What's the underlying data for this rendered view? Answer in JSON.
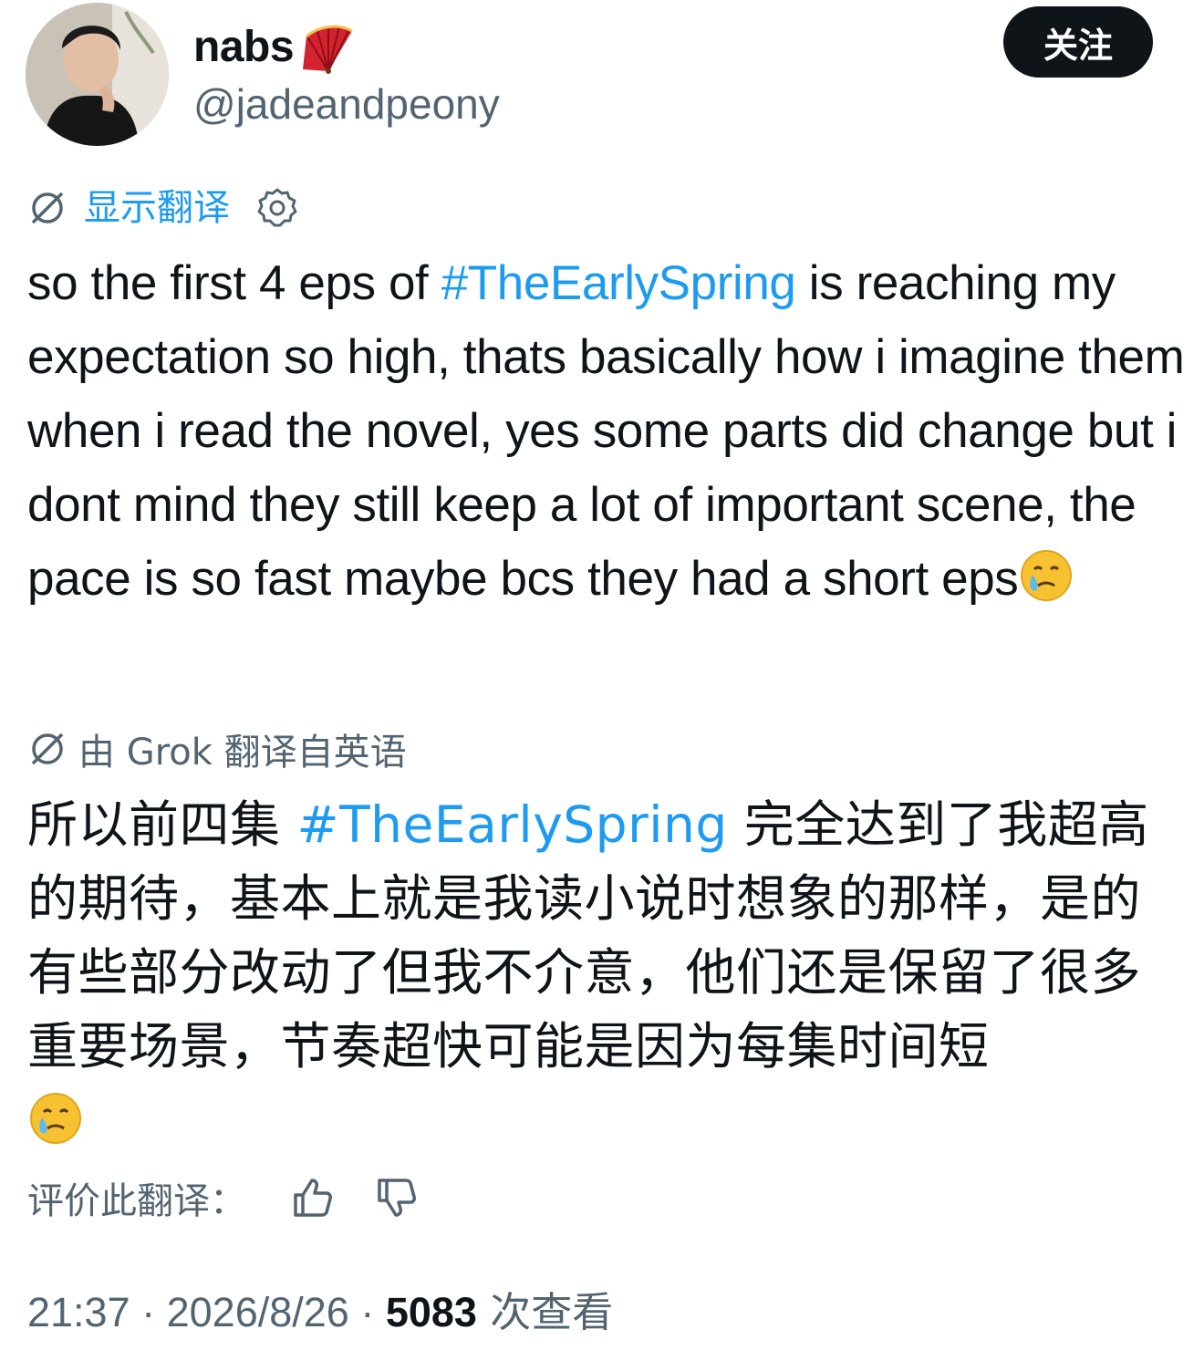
{
  "author": {
    "name": "nabs",
    "handle": "@jadeandpeony",
    "name_emoji": "folding-fan-icon"
  },
  "follow_button": {
    "label": "关注"
  },
  "translate_bar": {
    "label": "显示翻译",
    "icon": "translate-slash-icon",
    "settings_icon": "gear-icon"
  },
  "tweet": {
    "en_before": "so the first 4 eps of ",
    "hashtag": "#TheEarlySpring",
    "en_after": " is reaching my expectation so high, thats basically how i imagine them when i read the novel, yes some parts did change but i dont mind they still keep a lot of important scene, the pace is so fast maybe bcs they had a short eps",
    "emoji": "crying-smile-icon"
  },
  "grok": {
    "label": "由 Grok 翻译自英语",
    "zh_before": "所以前四集 ",
    "hashtag": "#TheEarlySpring",
    "zh_after": " 完全达到了我超高的期待，基本上就是我读小说时想象的那样，是的有些部分改动了但我不介意，他们还是保留了很多重要场景，节奏超快可能是因为每集时间短"
  },
  "rating": {
    "label": "评价此翻译：",
    "up_icon": "thumbs-up-icon",
    "down_icon": "thumbs-down-icon"
  },
  "meta": {
    "time": "21:37",
    "sep": " · ",
    "date": "2026/8/26",
    "views": "5083",
    "views_label": " 次查看"
  },
  "colors": {
    "link": "#1d9bf0",
    "secondary": "#536471",
    "primary": "#0f1419",
    "button_bg": "#0f1419"
  }
}
